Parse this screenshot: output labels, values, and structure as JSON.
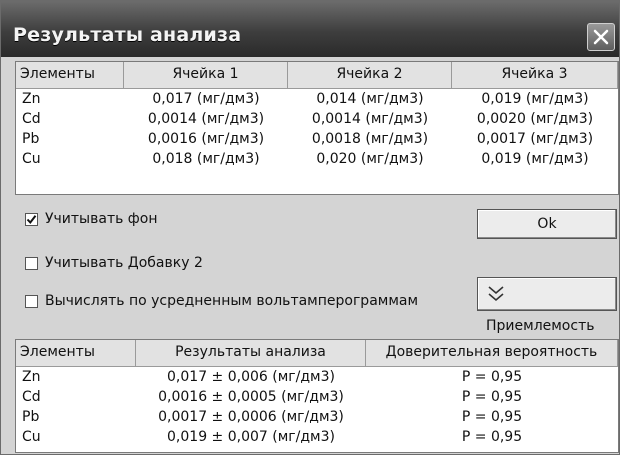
{
  "window": {
    "title": "Результаты анализа",
    "close_icon": "close-icon"
  },
  "cells_table": {
    "headers": [
      "Элементы",
      "Ячейка 1",
      "Ячейка 2",
      "Ячейка 3"
    ],
    "rows": [
      [
        "Zn",
        "0,017  (мг/дм3)",
        "0,014  (мг/дм3)",
        "0,019  (мг/дм3)"
      ],
      [
        "Cd",
        "0,0014  (мг/дм3)",
        "0,0014  (мг/дм3)",
        "0,0020  (мг/дм3)"
      ],
      [
        "Pb",
        "0,0016  (мг/дм3)",
        "0,0018  (мг/дм3)",
        "0,0017  (мг/дм3)"
      ],
      [
        "Cu",
        "0,018  (мг/дм3)",
        "0,020  (мг/дм3)",
        "0,019  (мг/дм3)"
      ]
    ]
  },
  "options": {
    "background": {
      "label": "Учитывать фон",
      "checked": true
    },
    "addition": {
      "label": "Учитывать Добавку 2",
      "checked": false
    },
    "averaged": {
      "label": "Вычислять по усредненным вольтамперограммам",
      "checked": false
    },
    "ok_label": "Ok",
    "accept_label": "Приемлемость",
    "accept_icon": "double-chevron-down-icon"
  },
  "results_table": {
    "headers": [
      "Элементы",
      "Результаты анализа",
      "Доверительная вероятность"
    ],
    "rows": [
      [
        "Zn",
        "0,017 ± 0,006  (мг/дм3)",
        "P = 0,95"
      ],
      [
        "Cd",
        "0,0016 ± 0,0005  (мг/дм3)",
        "P = 0,95"
      ],
      [
        "Pb",
        "0,0017 ± 0,0006  (мг/дм3)",
        "P = 0,95"
      ],
      [
        "Cu",
        "0,019 ± 0,007  (мг/дм3)",
        "P = 0,95"
      ]
    ]
  }
}
